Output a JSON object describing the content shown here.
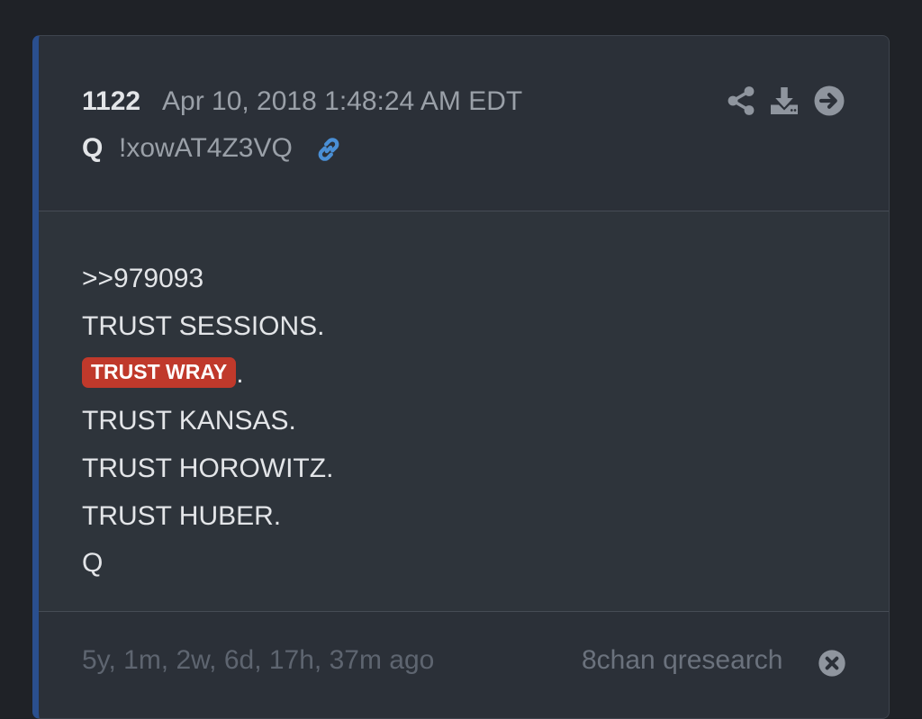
{
  "post": {
    "number": "1122",
    "date": "Apr 10, 2018 1:48:24 AM EDT",
    "author": "Q",
    "tripcode": "!xowAT4Z3VQ"
  },
  "icons": {
    "link": "link-icon",
    "share": "share-icon",
    "download": "download-icon",
    "open": "arrow-circle-right-icon",
    "close": "close-circle-icon"
  },
  "body": {
    "reply_ref": ">>979093",
    "line_sessions": "TRUST SESSIONS.",
    "highlight": "TRUST WRAY",
    "highlight_suffix": ".",
    "line_kansas": "TRUST KANSAS.",
    "line_horowitz": "TRUST HOROWITZ.",
    "line_huber": "TRUST HUBER.",
    "signature": "Q"
  },
  "footer": {
    "age": "5y, 1m, 2w, 6d, 17h, 37m ago",
    "source": "8chan qresearch"
  },
  "colors": {
    "accent": "#2a4f8e",
    "highlight_bg": "#c0392b",
    "link": "#4a8fd6"
  }
}
